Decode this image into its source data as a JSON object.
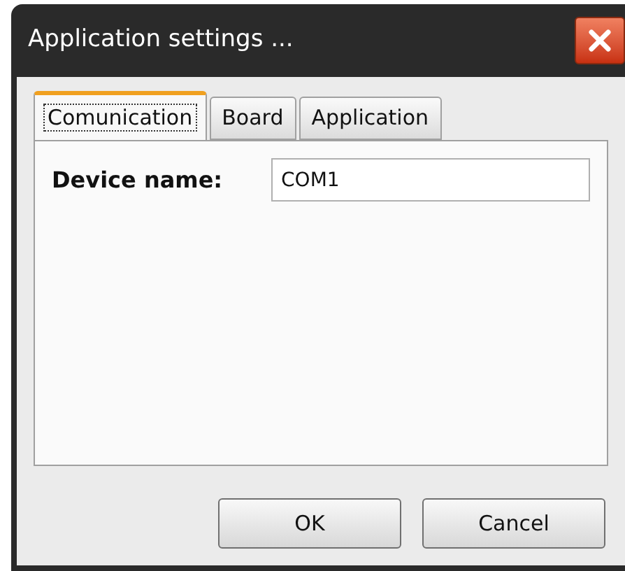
{
  "window": {
    "title": "Application settings ..."
  },
  "tabs": [
    {
      "label": "Comunication",
      "selected": true
    },
    {
      "label": "Board",
      "selected": false
    },
    {
      "label": "Application",
      "selected": false
    }
  ],
  "fields": [
    {
      "label": "Device name:",
      "value": "COM1"
    }
  ],
  "buttons": [
    "OK",
    "Cancel"
  ]
}
